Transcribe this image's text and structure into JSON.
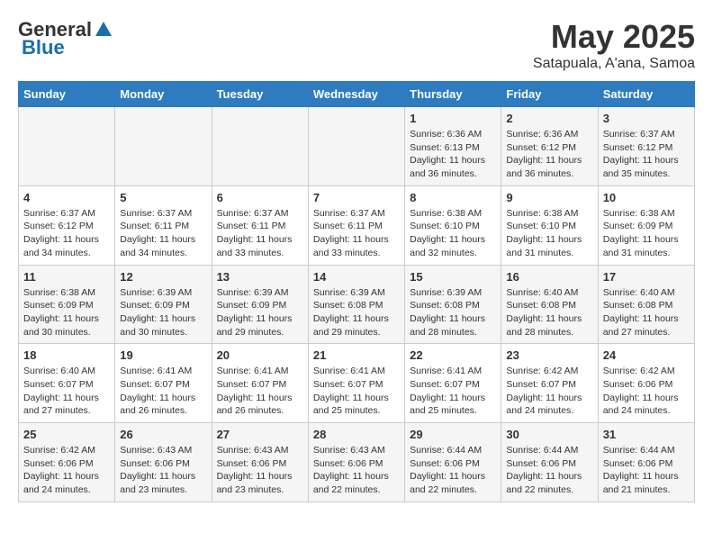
{
  "header": {
    "logo_general": "General",
    "logo_blue": "Blue",
    "month_title": "May 2025",
    "subtitle": "Satapuala, A'ana, Samoa"
  },
  "days_of_week": [
    "Sunday",
    "Monday",
    "Tuesday",
    "Wednesday",
    "Thursday",
    "Friday",
    "Saturday"
  ],
  "weeks": [
    [
      {
        "num": "",
        "detail": ""
      },
      {
        "num": "",
        "detail": ""
      },
      {
        "num": "",
        "detail": ""
      },
      {
        "num": "",
        "detail": ""
      },
      {
        "num": "1",
        "detail": "Sunrise: 6:36 AM\nSunset: 6:13 PM\nDaylight: 11 hours\nand 36 minutes."
      },
      {
        "num": "2",
        "detail": "Sunrise: 6:36 AM\nSunset: 6:12 PM\nDaylight: 11 hours\nand 36 minutes."
      },
      {
        "num": "3",
        "detail": "Sunrise: 6:37 AM\nSunset: 6:12 PM\nDaylight: 11 hours\nand 35 minutes."
      }
    ],
    [
      {
        "num": "4",
        "detail": "Sunrise: 6:37 AM\nSunset: 6:12 PM\nDaylight: 11 hours\nand 34 minutes."
      },
      {
        "num": "5",
        "detail": "Sunrise: 6:37 AM\nSunset: 6:11 PM\nDaylight: 11 hours\nand 34 minutes."
      },
      {
        "num": "6",
        "detail": "Sunrise: 6:37 AM\nSunset: 6:11 PM\nDaylight: 11 hours\nand 33 minutes."
      },
      {
        "num": "7",
        "detail": "Sunrise: 6:37 AM\nSunset: 6:11 PM\nDaylight: 11 hours\nand 33 minutes."
      },
      {
        "num": "8",
        "detail": "Sunrise: 6:38 AM\nSunset: 6:10 PM\nDaylight: 11 hours\nand 32 minutes."
      },
      {
        "num": "9",
        "detail": "Sunrise: 6:38 AM\nSunset: 6:10 PM\nDaylight: 11 hours\nand 31 minutes."
      },
      {
        "num": "10",
        "detail": "Sunrise: 6:38 AM\nSunset: 6:09 PM\nDaylight: 11 hours\nand 31 minutes."
      }
    ],
    [
      {
        "num": "11",
        "detail": "Sunrise: 6:38 AM\nSunset: 6:09 PM\nDaylight: 11 hours\nand 30 minutes."
      },
      {
        "num": "12",
        "detail": "Sunrise: 6:39 AM\nSunset: 6:09 PM\nDaylight: 11 hours\nand 30 minutes."
      },
      {
        "num": "13",
        "detail": "Sunrise: 6:39 AM\nSunset: 6:09 PM\nDaylight: 11 hours\nand 29 minutes."
      },
      {
        "num": "14",
        "detail": "Sunrise: 6:39 AM\nSunset: 6:08 PM\nDaylight: 11 hours\nand 29 minutes."
      },
      {
        "num": "15",
        "detail": "Sunrise: 6:39 AM\nSunset: 6:08 PM\nDaylight: 11 hours\nand 28 minutes."
      },
      {
        "num": "16",
        "detail": "Sunrise: 6:40 AM\nSunset: 6:08 PM\nDaylight: 11 hours\nand 28 minutes."
      },
      {
        "num": "17",
        "detail": "Sunrise: 6:40 AM\nSunset: 6:08 PM\nDaylight: 11 hours\nand 27 minutes."
      }
    ],
    [
      {
        "num": "18",
        "detail": "Sunrise: 6:40 AM\nSunset: 6:07 PM\nDaylight: 11 hours\nand 27 minutes."
      },
      {
        "num": "19",
        "detail": "Sunrise: 6:41 AM\nSunset: 6:07 PM\nDaylight: 11 hours\nand 26 minutes."
      },
      {
        "num": "20",
        "detail": "Sunrise: 6:41 AM\nSunset: 6:07 PM\nDaylight: 11 hours\nand 26 minutes."
      },
      {
        "num": "21",
        "detail": "Sunrise: 6:41 AM\nSunset: 6:07 PM\nDaylight: 11 hours\nand 25 minutes."
      },
      {
        "num": "22",
        "detail": "Sunrise: 6:41 AM\nSunset: 6:07 PM\nDaylight: 11 hours\nand 25 minutes."
      },
      {
        "num": "23",
        "detail": "Sunrise: 6:42 AM\nSunset: 6:07 PM\nDaylight: 11 hours\nand 24 minutes."
      },
      {
        "num": "24",
        "detail": "Sunrise: 6:42 AM\nSunset: 6:06 PM\nDaylight: 11 hours\nand 24 minutes."
      }
    ],
    [
      {
        "num": "25",
        "detail": "Sunrise: 6:42 AM\nSunset: 6:06 PM\nDaylight: 11 hours\nand 24 minutes."
      },
      {
        "num": "26",
        "detail": "Sunrise: 6:43 AM\nSunset: 6:06 PM\nDaylight: 11 hours\nand 23 minutes."
      },
      {
        "num": "27",
        "detail": "Sunrise: 6:43 AM\nSunset: 6:06 PM\nDaylight: 11 hours\nand 23 minutes."
      },
      {
        "num": "28",
        "detail": "Sunrise: 6:43 AM\nSunset: 6:06 PM\nDaylight: 11 hours\nand 22 minutes."
      },
      {
        "num": "29",
        "detail": "Sunrise: 6:44 AM\nSunset: 6:06 PM\nDaylight: 11 hours\nand 22 minutes."
      },
      {
        "num": "30",
        "detail": "Sunrise: 6:44 AM\nSunset: 6:06 PM\nDaylight: 11 hours\nand 22 minutes."
      },
      {
        "num": "31",
        "detail": "Sunrise: 6:44 AM\nSunset: 6:06 PM\nDaylight: 11 hours\nand 21 minutes."
      }
    ]
  ]
}
